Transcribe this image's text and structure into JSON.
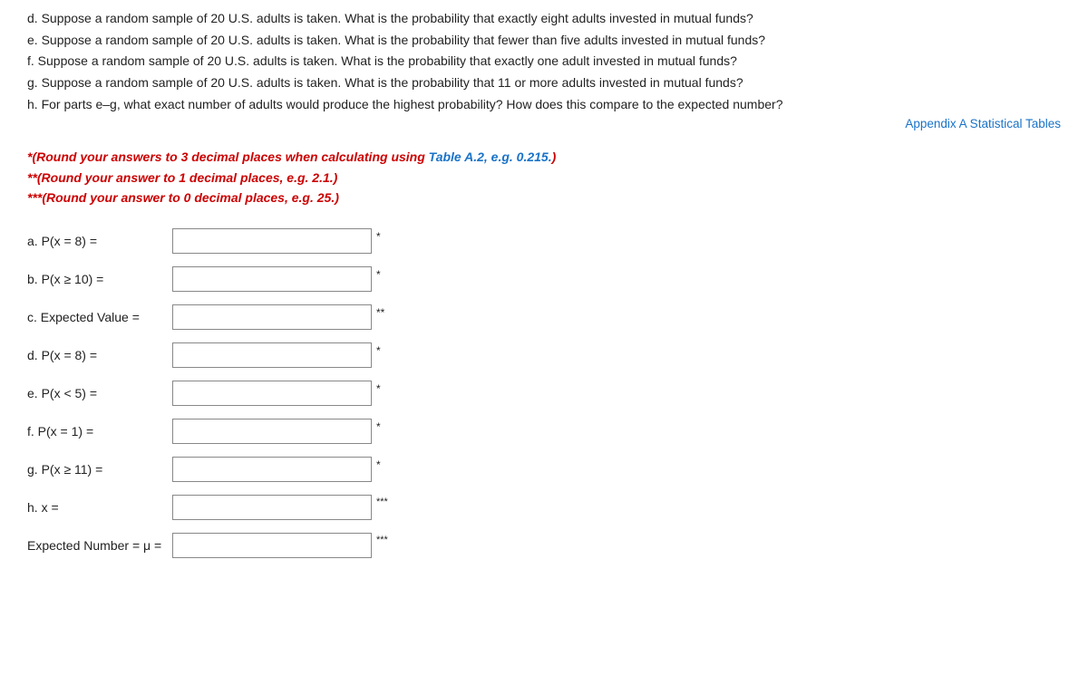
{
  "problem_lines": {
    "line_d": "d. Suppose a random sample of 20 U.S. adults is taken. What is the probability that exactly eight adults invested in mutual funds?",
    "line_e": "e. Suppose a random sample of 20 U.S. adults is taken. What is the probability that fewer than  five adults invested in mutual funds?",
    "line_f": "f. Suppose a random sample of 20 U.S. adults is taken. What is the probability that  exactly one adult invested in mutual funds?",
    "line_g": "g. Suppose a random sample of 20 U.S. adults is taken. What is the probability that  11 or more adults invested in mutual funds?",
    "line_h": "h. For parts e–g, what exact number of adults would produce the highest probability? How does this compare to the expected number?"
  },
  "appendix_link": "Appendix A Statistical Tables",
  "notes": {
    "note1_prefix": "*(Round your answers to 3 decimal places when calculating using ",
    "note1_table": "Table A.2, e.g. 0.215.",
    "note1_suffix": ")",
    "note2": "**(Round your answer to 1 decimal places, e.g. 2.1.)",
    "note3": "***(Round your answer to 0 decimal places, e.g. 25.)"
  },
  "form_fields": {
    "a_label": "a. P(x = 8) =",
    "b_label": "b. P(x ≥ 10) =",
    "c_label": "c. Expected Value =",
    "d_label": "d. P(x = 8) =",
    "e_label": "e. P(x < 5) =",
    "f_label": "f. P(x = 1) =",
    "g_label": "g. P(x ≥ 11) =",
    "h_label": "h. x =",
    "expected_label": "Expected Number = μ =",
    "asterisk_single": "*",
    "asterisk_double": "**",
    "asterisk_triple": "***"
  }
}
